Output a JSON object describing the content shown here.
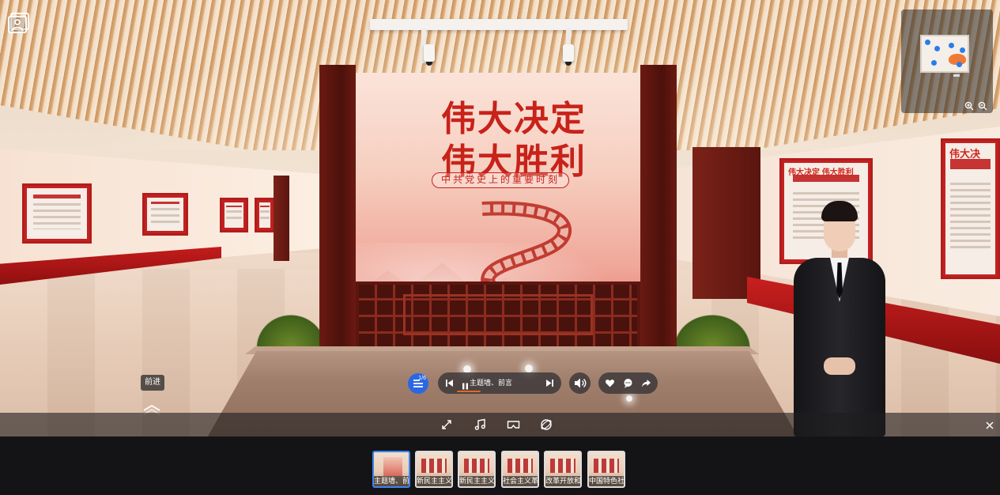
{
  "poster": {
    "title_line1": "伟大决定",
    "title_line2": "伟大胜利",
    "subtitle": "中共党史上的重要时刻"
  },
  "side_panels": {
    "right_panel_title": "伟大决定 伟大胜利",
    "far_right_panel_title": "伟大决"
  },
  "tooltip": {
    "forward": "前进"
  },
  "playlist": {
    "counter": "1/6",
    "current_title": "主题墙、前言"
  },
  "minimap": {
    "zoom_in_icon": "zoom-in-icon",
    "zoom_out_icon": "zoom-out-icon"
  },
  "toolbar": {
    "icons": [
      "fullscreen-icon",
      "music-icon",
      "vr-glasses-icon",
      "gyroscope-icon",
      "close-icon"
    ]
  },
  "thumbnails": [
    {
      "caption": "主题墙、前言",
      "active": true
    },
    {
      "caption": "新民主主义...",
      "active": false
    },
    {
      "caption": "新民主主义...",
      "active": false
    },
    {
      "caption": "社会主义革...",
      "active": false
    },
    {
      "caption": "改革开放和...",
      "active": false
    },
    {
      "caption": "中国特色社...",
      "active": false
    }
  ],
  "colors": {
    "accent_blue": "#2b67e3",
    "poster_red": "#c8221a",
    "progress_orange": "#e26c24"
  }
}
